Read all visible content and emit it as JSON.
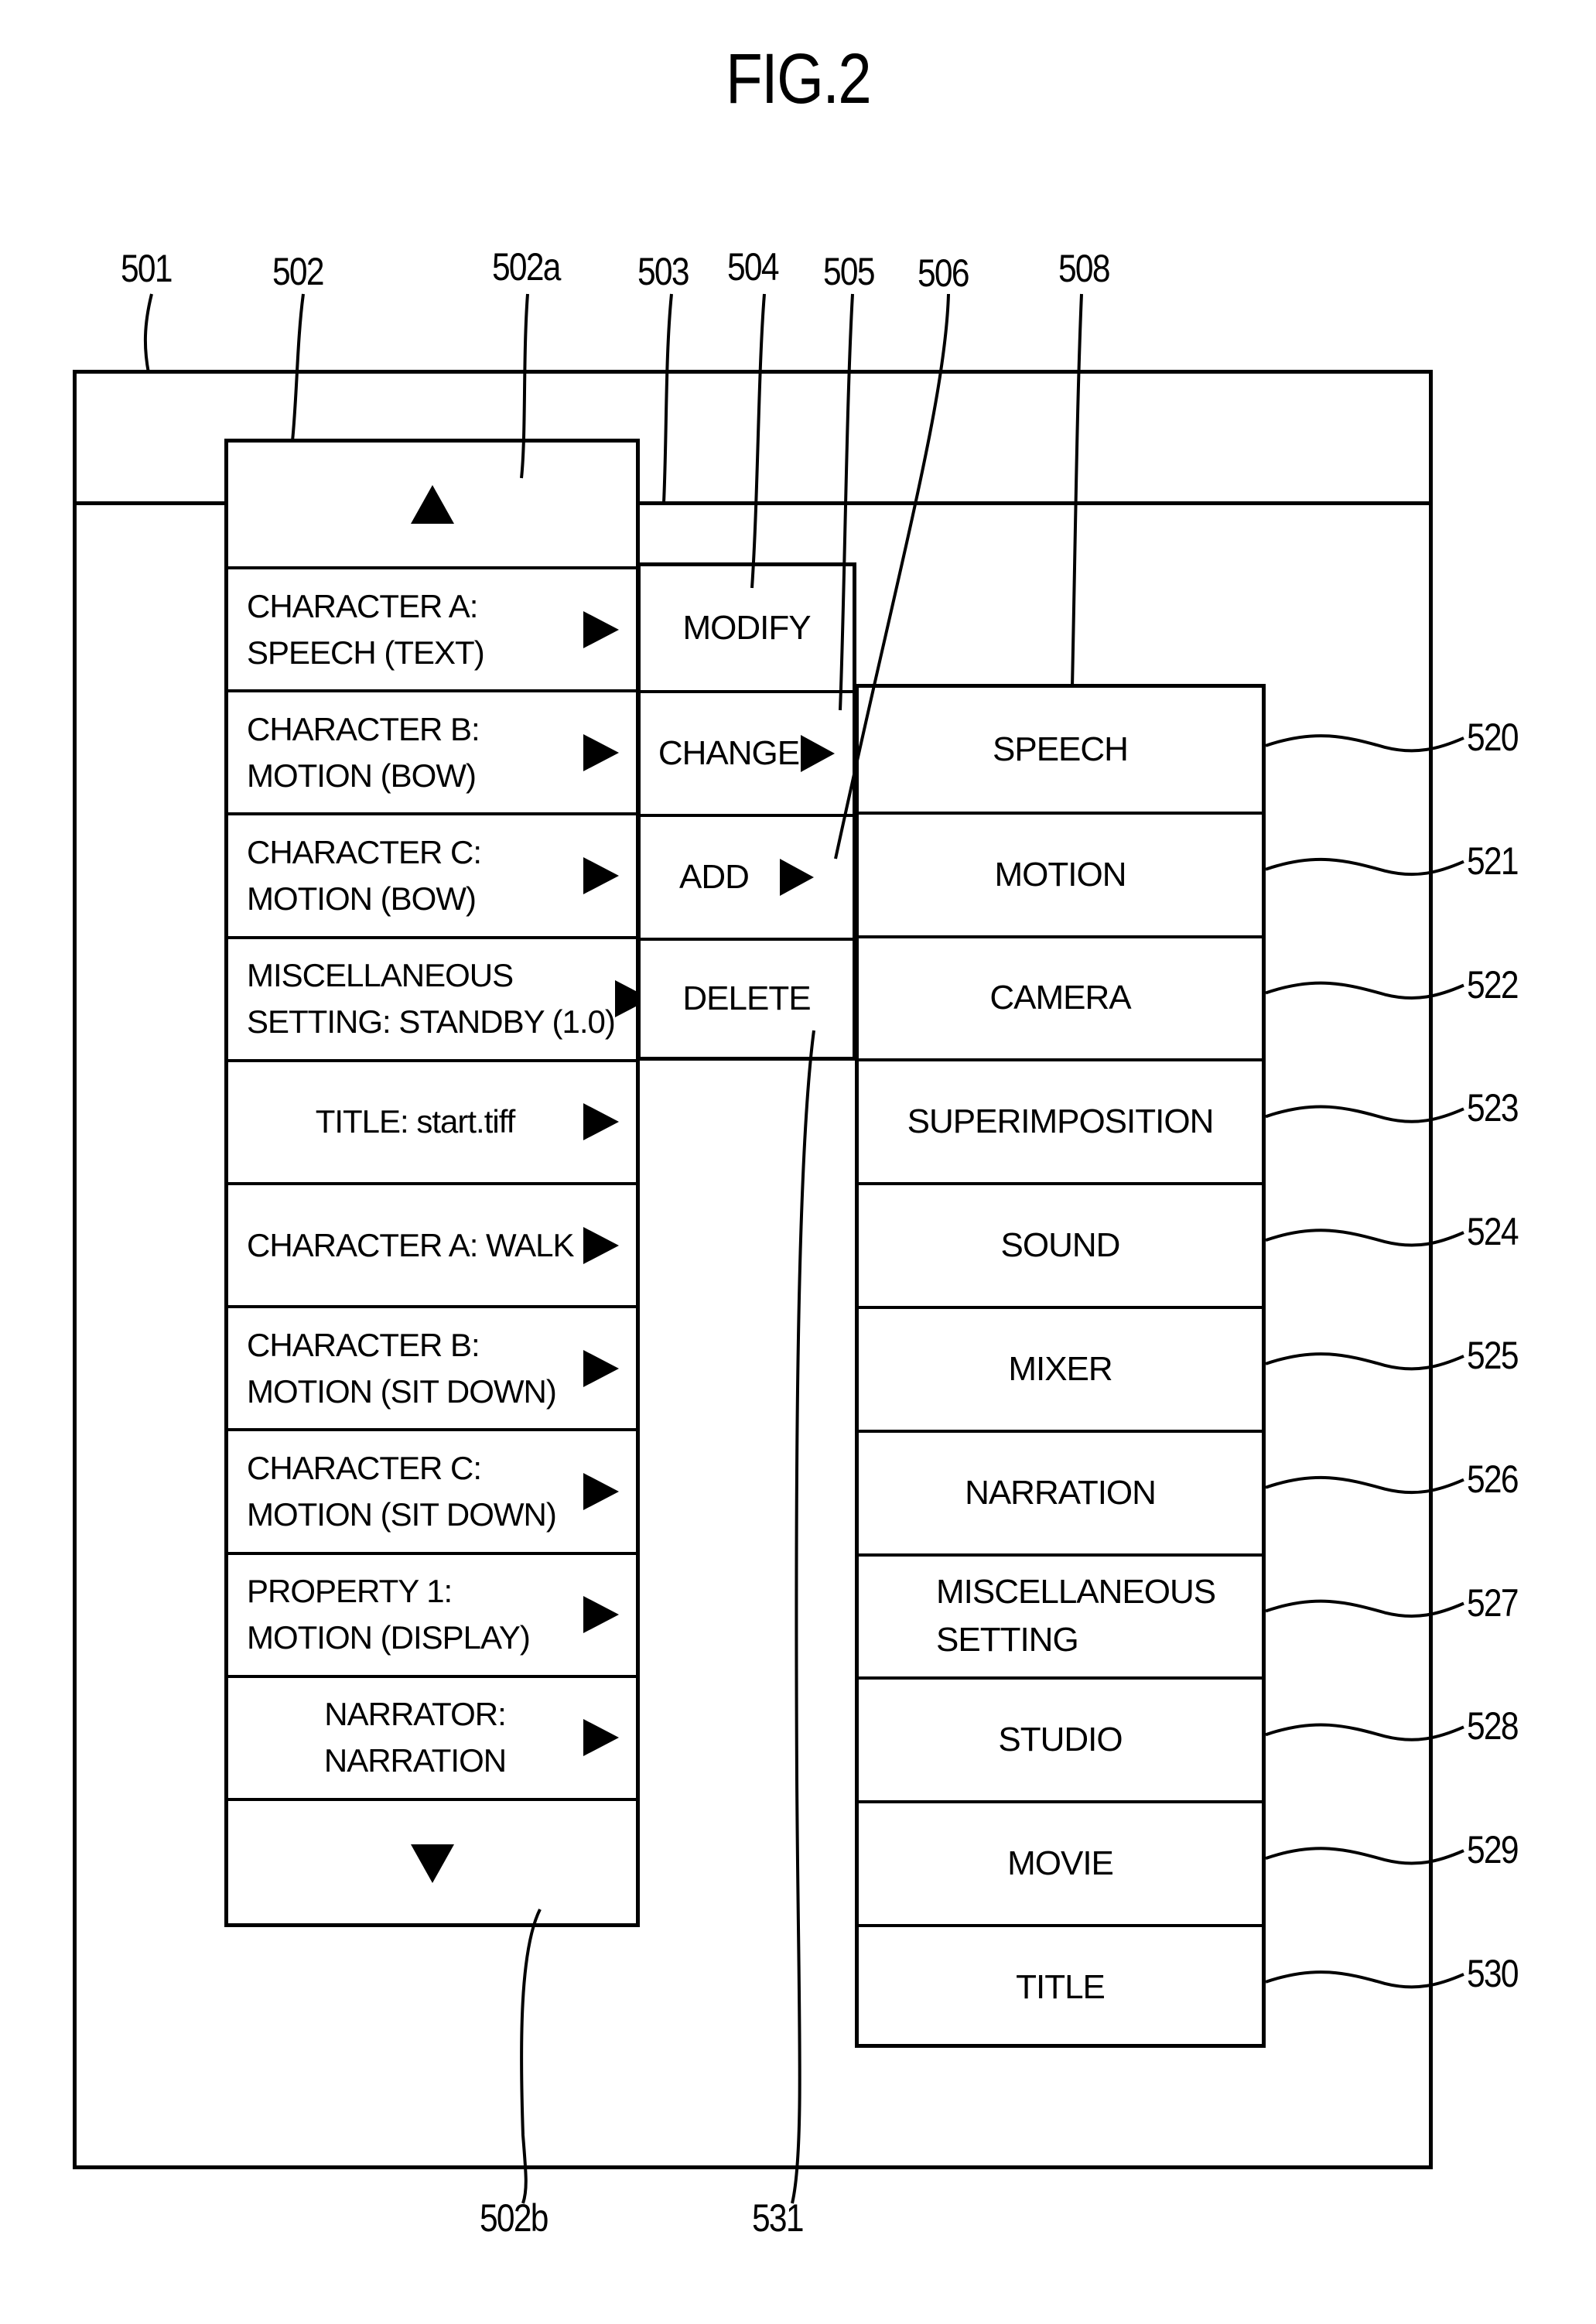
{
  "figure": {
    "title": "FIG.2"
  },
  "reference_numerals": {
    "window": "501",
    "list": "502",
    "scroll_up": "502a",
    "scroll_down": "502b",
    "display_area": "503",
    "modify": "504",
    "change": "505",
    "add": "506",
    "submenu": "508",
    "delete": "531",
    "submenu_items": [
      "520",
      "521",
      "522",
      "523",
      "524",
      "525",
      "526",
      "527",
      "528",
      "529",
      "530"
    ]
  },
  "list": {
    "scroll_up_icon": "triangle-up",
    "scroll_down_icon": "triangle-down",
    "rows": [
      {
        "line1": "CHARACTER A:",
        "line2": "SPEECH (TEXT)",
        "align": "left"
      },
      {
        "line1": "CHARACTER B:",
        "line2": "MOTION (BOW)",
        "align": "left"
      },
      {
        "line1": "CHARACTER C:",
        "line2": "MOTION (BOW)",
        "align": "left"
      },
      {
        "line1": "MISCELLANEOUS",
        "line2": "SETTING: STANDBY (1.0)",
        "align": "left"
      },
      {
        "line1": "TITLE: start.tiff",
        "line2": "",
        "align": "center"
      },
      {
        "line1": "CHARACTER A: WALK",
        "line2": "",
        "align": "left"
      },
      {
        "line1": "CHARACTER B:",
        "line2": "MOTION (SIT DOWN)",
        "align": "left"
      },
      {
        "line1": "CHARACTER C:",
        "line2": "MOTION (SIT DOWN)",
        "align": "left"
      },
      {
        "line1": "PROPERTY 1:",
        "line2": "MOTION (DISPLAY)",
        "align": "left"
      },
      {
        "line1": "NARRATOR:",
        "line2": "NARRATION",
        "align": "center"
      }
    ]
  },
  "context_menu": {
    "items": [
      {
        "label": "MODIFY",
        "has_submenu": false
      },
      {
        "label": "CHANGE",
        "has_submenu": true
      },
      {
        "label": "ADD",
        "has_submenu": true
      },
      {
        "label": "DELETE",
        "has_submenu": false
      }
    ]
  },
  "submenu": {
    "items": [
      {
        "line1": "SPEECH",
        "line2": ""
      },
      {
        "line1": "MOTION",
        "line2": ""
      },
      {
        "line1": "CAMERA",
        "line2": ""
      },
      {
        "line1": "SUPERIMPOSITION",
        "line2": ""
      },
      {
        "line1": "SOUND",
        "line2": ""
      },
      {
        "line1": "MIXER",
        "line2": ""
      },
      {
        "line1": "NARRATION",
        "line2": ""
      },
      {
        "line1": "MISCELLANEOUS",
        "line2": "SETTING"
      },
      {
        "line1": "STUDIO",
        "line2": ""
      },
      {
        "line1": "MOVIE",
        "line2": ""
      },
      {
        "line1": "TITLE",
        "line2": ""
      }
    ]
  }
}
